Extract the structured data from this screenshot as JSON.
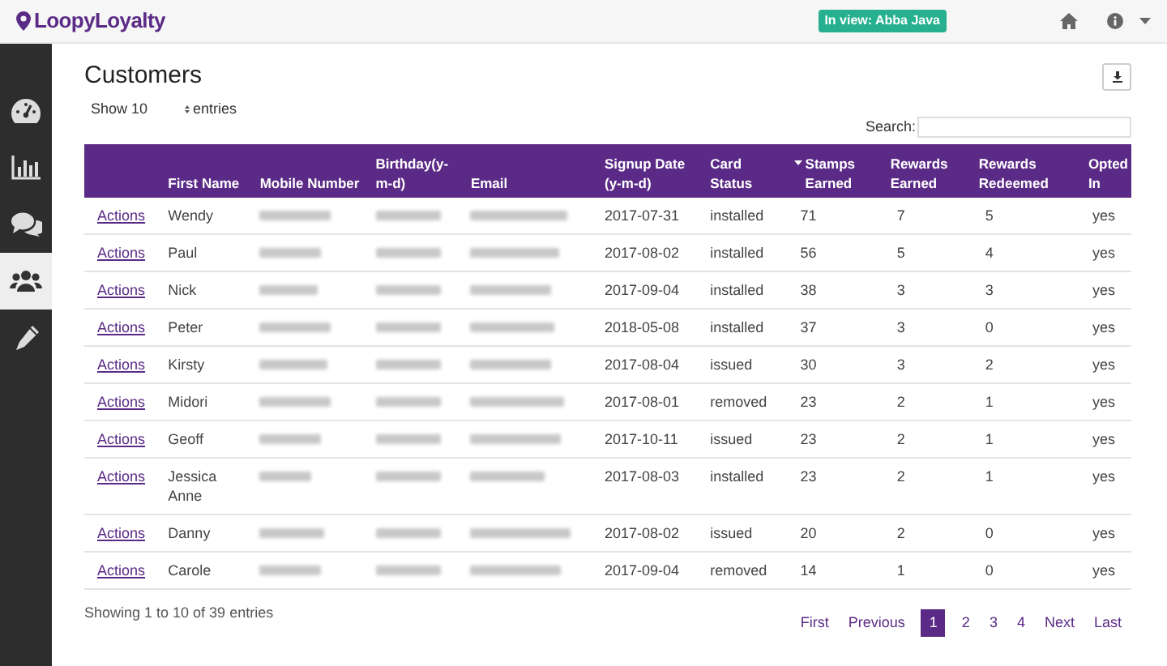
{
  "brand": {
    "name": "LoopyLoyalty"
  },
  "topbar": {
    "view_badge": "In view: Abba Java"
  },
  "sidebar": {
    "items": [
      {
        "kind": "dashboard",
        "selected": false
      },
      {
        "kind": "chart",
        "selected": false
      },
      {
        "kind": "chat",
        "selected": false
      },
      {
        "kind": "users",
        "selected": true
      },
      {
        "kind": "edit",
        "selected": false
      }
    ]
  },
  "page": {
    "title": "Customers"
  },
  "controls": {
    "show_label": "Show 10",
    "entries_label": "entries",
    "search_label": "Search:"
  },
  "table": {
    "columns": [
      {
        "sorted": false
      },
      {
        "label": "First Name",
        "sorted": false
      },
      {
        "label": "Mobile Number",
        "sorted": false
      },
      {
        "label": "Birthday(y-m-d)",
        "sorted": false
      },
      {
        "label": "Email",
        "sorted": false
      },
      {
        "label": "Signup Date (y-m-d)",
        "sorted": false
      },
      {
        "label": "Card Status",
        "sorted": false
      },
      {
        "label": "Stamps Earned",
        "sorted": true
      },
      {
        "label": "Rewards Earned",
        "sorted": false
      },
      {
        "label": "Rewards Redeemed",
        "sorted": false
      },
      {
        "label": "Opted In",
        "sorted": false
      }
    ],
    "rows": [
      {
        "action": "Actions",
        "first_name": "Wendy",
        "signup": "2017-07-31",
        "card_status": "installed",
        "stamps": "71",
        "rewards_earned": "7",
        "rewards_redeemed": "5",
        "opted_in": "yes"
      },
      {
        "action": "Actions",
        "first_name": "Paul",
        "signup": "2017-08-02",
        "card_status": "installed",
        "stamps": "56",
        "rewards_earned": "5",
        "rewards_redeemed": "4",
        "opted_in": "yes"
      },
      {
        "action": "Actions",
        "first_name": "Nick",
        "signup": "2017-09-04",
        "card_status": "installed",
        "stamps": "38",
        "rewards_earned": "3",
        "rewards_redeemed": "3",
        "opted_in": "yes"
      },
      {
        "action": "Actions",
        "first_name": "Peter",
        "signup": "2018-05-08",
        "card_status": "installed",
        "stamps": "37",
        "rewards_earned": "3",
        "rewards_redeemed": "0",
        "opted_in": "yes"
      },
      {
        "action": "Actions",
        "first_name": "Kirsty",
        "signup": "2017-08-04",
        "card_status": "issued",
        "stamps": "30",
        "rewards_earned": "3",
        "rewards_redeemed": "2",
        "opted_in": "yes"
      },
      {
        "action": "Actions",
        "first_name": "Midori",
        "signup": "2017-08-01",
        "card_status": "removed",
        "stamps": "23",
        "rewards_earned": "2",
        "rewards_redeemed": "1",
        "opted_in": "yes"
      },
      {
        "action": "Actions",
        "first_name": "Geoff",
        "signup": "2017-10-11",
        "card_status": "issued",
        "stamps": "23",
        "rewards_earned": "2",
        "rewards_redeemed": "1",
        "opted_in": "yes"
      },
      {
        "action": "Actions",
        "first_name": "Jessica Anne",
        "signup": "2017-08-03",
        "card_status": "installed",
        "stamps": "23",
        "rewards_earned": "2",
        "rewards_redeemed": "1",
        "opted_in": "yes"
      },
      {
        "action": "Actions",
        "first_name": "Danny",
        "signup": "2017-08-02",
        "card_status": "issued",
        "stamps": "20",
        "rewards_earned": "2",
        "rewards_redeemed": "0",
        "opted_in": "yes"
      },
      {
        "action": "Actions",
        "first_name": "Carole",
        "signup": "2017-09-04",
        "card_status": "removed",
        "stamps": "14",
        "rewards_earned": "1",
        "rewards_redeemed": "0",
        "opted_in": "yes"
      }
    ]
  },
  "footer": {
    "info": "Showing 1 to 10 of 39 entries"
  },
  "pagination": [
    {
      "label": "First",
      "selected": false
    },
    {
      "label": "Previous",
      "selected": false
    },
    {
      "label": "1",
      "selected": true
    },
    {
      "label": "2",
      "selected": false
    },
    {
      "label": "3",
      "selected": false
    },
    {
      "label": "4",
      "selected": false
    },
    {
      "label": "Next",
      "selected": false
    },
    {
      "label": "Last",
      "selected": false
    }
  ]
}
